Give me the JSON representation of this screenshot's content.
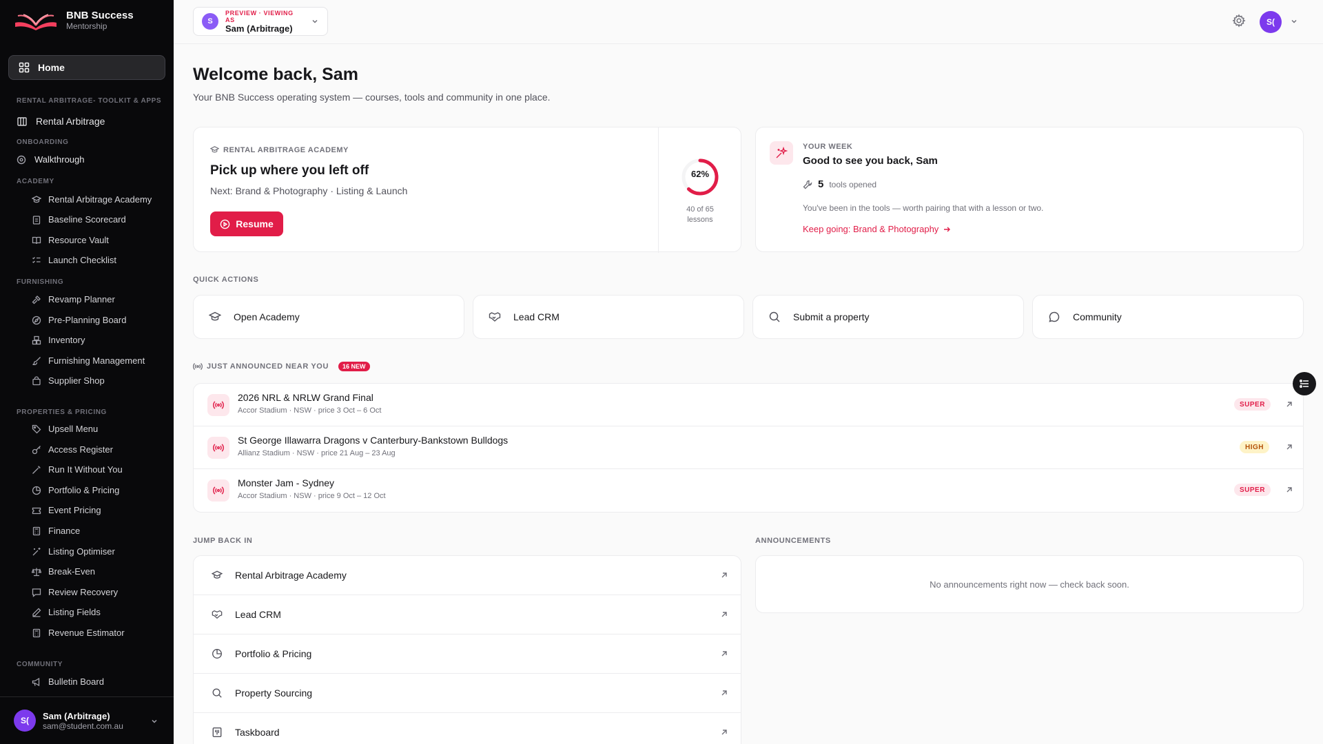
{
  "brand": {
    "name": "BNB Success",
    "sub": "Mentorship"
  },
  "sidebar": {
    "home": "Home",
    "sections": [
      {
        "label": "RENTAL ARBITRAGE- TOOLKIT & APPS"
      },
      {
        "label": "ONBOARDING"
      },
      {
        "label": "ACADEMY"
      },
      {
        "label": "FURNISHING"
      },
      {
        "label": "PROPERTIES & PRICING"
      },
      {
        "label": "COMMUNITY"
      }
    ],
    "top_items": [
      {
        "label": "Rental Arbitrage",
        "icon": "building-icon"
      },
      {
        "label": "Walkthrough",
        "icon": "compass-icon"
      }
    ],
    "academy": [
      {
        "label": "Rental Arbitrage Academy",
        "icon": "graduation-cap-icon"
      },
      {
        "label": "Baseline Scorecard",
        "icon": "clipboard-icon"
      },
      {
        "label": "Resource Vault",
        "icon": "book-icon"
      },
      {
        "label": "Launch Checklist",
        "icon": "checklist-icon"
      }
    ],
    "furnishing": [
      {
        "label": "Revamp Planner",
        "icon": "hammer-icon"
      },
      {
        "label": "Pre-Planning Board",
        "icon": "compass-icon"
      },
      {
        "label": "Inventory",
        "icon": "boxes-icon"
      },
      {
        "label": "Furnishing Management",
        "icon": "paintbrush-icon"
      },
      {
        "label": "Supplier Shop",
        "icon": "bag-icon"
      }
    ],
    "properties": [
      {
        "label": "Upsell Menu",
        "icon": "tag-icon"
      },
      {
        "label": "Access Register",
        "icon": "key-icon"
      },
      {
        "label": "Run It Without You",
        "icon": "wand-icon"
      },
      {
        "label": "Portfolio & Pricing",
        "icon": "pie-chart-icon"
      },
      {
        "label": "Event Pricing",
        "icon": "ticket-icon"
      },
      {
        "label": "Finance",
        "icon": "calculator-icon"
      },
      {
        "label": "Listing Optimiser",
        "icon": "sparkle-wand-icon"
      },
      {
        "label": "Break-Even",
        "icon": "scale-icon"
      },
      {
        "label": "Review Recovery",
        "icon": "message-icon"
      },
      {
        "label": "Listing Fields",
        "icon": "pencil-icon"
      },
      {
        "label": "Revenue Estimator",
        "icon": "calculator-icon"
      }
    ],
    "community": [
      {
        "label": "Bulletin Board",
        "icon": "megaphone-icon"
      }
    ],
    "user": {
      "initials": "S(",
      "name": "Sam (Arbitrage)",
      "email": "sam@student.com.au"
    }
  },
  "topbar": {
    "view_as": {
      "initial": "S",
      "label": "PREVIEW · VIEWING AS",
      "name": "Sam (Arbitrage)"
    },
    "avatar_initials": "S("
  },
  "main": {
    "title": "Welcome back, Sam",
    "subtitle": "Your BNB Success operating system — courses, tools and community in one place.",
    "continue_card": {
      "eyebrow": "RENTAL ARBITRAGE ACADEMY",
      "title": "Pick up where you left off",
      "next": "Next: Brand & Photography · Listing & Launch",
      "button": "Resume",
      "progress_percent": 62,
      "progress_label": "62%",
      "lessons_line1": "40 of 65",
      "lessons_line2": "lessons"
    },
    "week_card": {
      "eyebrow": "YOUR WEEK",
      "title": "Good to see you back, Sam",
      "tools_count": "5",
      "tools_label": "tools opened",
      "note": "You've been in the tools — worth pairing that with a lesson or two.",
      "link": "Keep going: Brand & Photography"
    },
    "quick_actions_label": "QUICK ACTIONS",
    "quick_actions": [
      {
        "label": "Open Academy",
        "icon": "graduation-cap-icon"
      },
      {
        "label": "Lead CRM",
        "icon": "handshake-icon"
      },
      {
        "label": "Submit a property",
        "icon": "search-icon"
      },
      {
        "label": "Community",
        "icon": "chat-bubble-icon"
      }
    ],
    "events_label": "JUST ANNOUNCED NEAR YOU",
    "events_badge": "16 new",
    "events": [
      {
        "title": "2026 NRL & NRLW Grand Final",
        "meta": "Accor Stadium · NSW · price 3 Oct – 6 Oct",
        "badge": "SUPER"
      },
      {
        "title": "St George Illawarra Dragons v Canterbury-Bankstown Bulldogs",
        "meta": "Allianz Stadium · NSW · price 21 Aug – 23 Aug",
        "badge": "HIGH"
      },
      {
        "title": "Monster Jam - Sydney",
        "meta": "Accor Stadium · NSW · price 9 Oct – 12 Oct",
        "badge": "SUPER"
      }
    ],
    "jump_back_label": "JUMP BACK IN",
    "jump_back": [
      {
        "label": "Rental Arbitrage Academy",
        "icon": "graduation-cap-icon"
      },
      {
        "label": "Lead CRM",
        "icon": "handshake-icon"
      },
      {
        "label": "Portfolio & Pricing",
        "icon": "pie-chart-icon"
      },
      {
        "label": "Property Sourcing",
        "icon": "search-icon"
      },
      {
        "label": "Taskboard",
        "icon": "kanban-icon"
      }
    ],
    "announcements_label": "ANNOUNCEMENTS",
    "announcements_empty": "No announcements right now — check back soon."
  },
  "colors": {
    "accent": "#e11d48",
    "sidebar_bg": "#09090b",
    "avatar": "#7c3aed"
  }
}
